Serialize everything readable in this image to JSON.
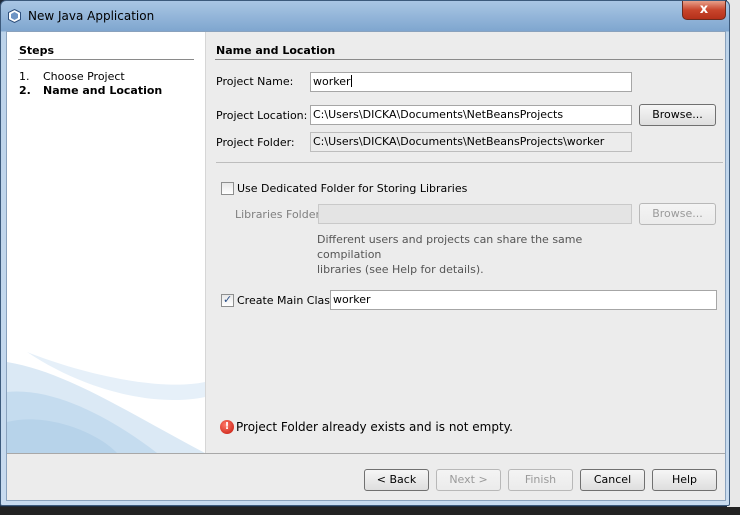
{
  "window": {
    "title": "New Java Application",
    "close_label": "x"
  },
  "steps": {
    "title": "Steps",
    "items": [
      {
        "num": "1.",
        "label": "Choose Project"
      },
      {
        "num": "2.",
        "label": "Name and Location"
      }
    ]
  },
  "main": {
    "title": "Name and Location",
    "project_name": {
      "label": "Project Name:",
      "value": "worker"
    },
    "project_location": {
      "label": "Project Location:",
      "value": "C:\\Users\\DICKA\\Documents\\NetBeansProjects",
      "browse": "Browse..."
    },
    "project_folder": {
      "label": "Project Folder:",
      "value": "C:\\Users\\DICKA\\Documents\\NetBeansProjects\\worker"
    },
    "dedicated_folder": {
      "label": "Use Dedicated Folder for Storing Libraries",
      "checked": false
    },
    "libraries_folder": {
      "label": "Libraries Folder:",
      "value": "",
      "browse": "Browse..."
    },
    "hint_line1": "Different users and projects can share the same compilation",
    "hint_line2": "libraries (see Help for details).",
    "create_main": {
      "label": "Create Main Class",
      "checked": true,
      "value": "worker"
    },
    "error": {
      "icon": "error-icon",
      "message": "Project Folder already exists and is not empty."
    }
  },
  "buttons": {
    "back": "< Back",
    "next": "Next >",
    "finish": "Finish",
    "cancel": "Cancel",
    "help": "Help"
  },
  "colors": {
    "accent": "#2a4e86",
    "error": "#c3160a"
  }
}
